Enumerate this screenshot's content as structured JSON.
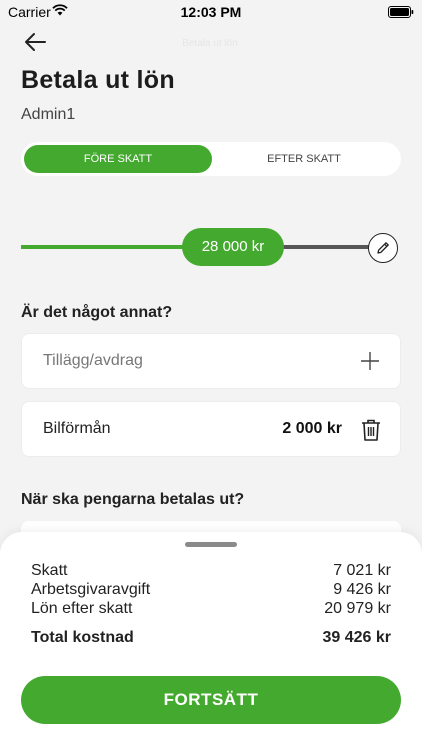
{
  "status": {
    "carrier": "Carrier",
    "time": "12:03 PM"
  },
  "nav": {
    "back_icon": "arrow-left-icon",
    "faded_title": "Betala ut lön"
  },
  "header": {
    "title": "Betala ut lön",
    "subtitle": "Admin1"
  },
  "segments": {
    "active_label": "FÖRE SKATT",
    "inactive_label": "EFTER SKATT",
    "selected": "FÖRE SKATT"
  },
  "slider": {
    "value_label": "28 000 kr",
    "edit_icon": "pencil-icon"
  },
  "extras": {
    "question": "Är det något annat?",
    "add_placeholder": "Tillägg/avdrag",
    "add_icon": "plus-icon",
    "items": [
      {
        "label": "Bilförmån",
        "amount": "2 000 kr",
        "icon": "trash-icon"
      }
    ]
  },
  "payout": {
    "question": "När ska pengarna betalas ut?"
  },
  "summary": {
    "rows": [
      {
        "label": "Skatt",
        "value": "7 021 kr"
      },
      {
        "label": "Arbetsgivaravgift",
        "value": "9 426 kr"
      },
      {
        "label": "Lön efter skatt",
        "value": "20 979 kr"
      }
    ],
    "total_label": "Total kostnad",
    "total_value": "39 426 kr",
    "cta_label": "FORTSÄTT"
  },
  "colors": {
    "accent": "#44aa2f",
    "background": "#f3f3f3"
  }
}
